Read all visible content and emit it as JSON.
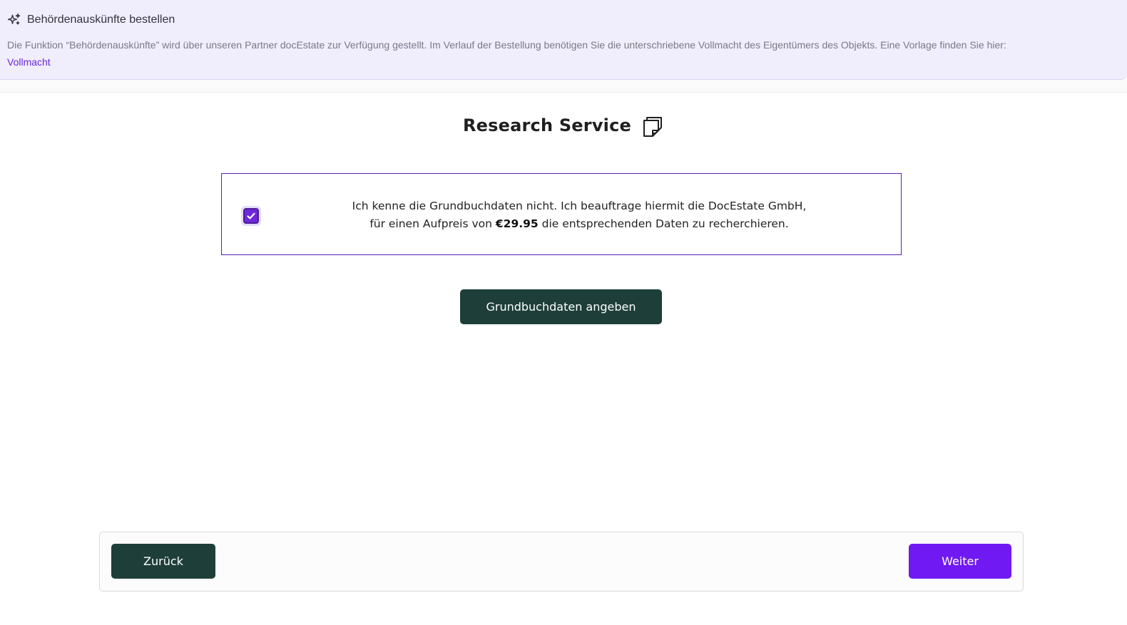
{
  "banner": {
    "title": "Behördenauskünfte bestellen",
    "text": "Die Funktion “Behördenauskünfte” wird über unseren Partner docEstate zur Verfügung gestellt. Im Verlauf der Bestellung benötigen Sie die unterschriebene Vollmacht des Eigentümers des Objekts. Eine Vorlage finden Sie hier:",
    "link_label": "Vollmacht",
    "icon": "sparkle-icon"
  },
  "heading": {
    "title": "Research Service",
    "icon": "sticky-note-icon"
  },
  "option": {
    "checked": true,
    "line1": "Ich kenne die Grundbuchdaten nicht. Ich beauftrage hiermit die DocEstate GmbH,",
    "line2_before": "für einen Aufpreis von",
    "price": "€29.95",
    "line2_after": "die entsprechenden Daten zu recherchieren."
  },
  "actions": {
    "grundbuch_label": "Grundbuchdaten angeben"
  },
  "footer": {
    "back_label": "Zurück",
    "next_label": "Weiter"
  },
  "colors": {
    "accent": "#7119f2",
    "dark_green": "#1e3f39",
    "banner_bg": "#f0edfd",
    "link": "#6d28d9"
  }
}
